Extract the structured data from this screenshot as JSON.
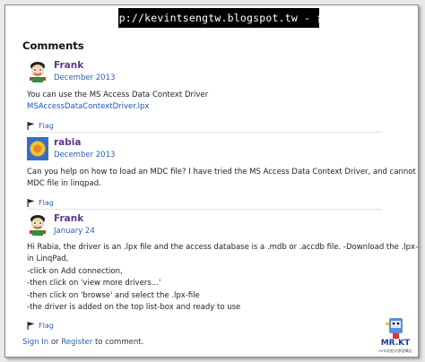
{
  "banner": {
    "text": "http://kevintsengtw.blogspot.tw - 台灣"
  },
  "comments_heading": "Comments",
  "comments": [
    {
      "author": "Frank",
      "date": "December 2013",
      "lines": [
        "You can use the MS Access Data Context Driver"
      ],
      "link": "MSAccessDataContextDriver.lpx",
      "flag": "Flag"
    },
    {
      "author": "rabia",
      "date": "December 2013",
      "lines": [
        "Can you help on how to load an MDC file? I have tried the MS Access Data Context Driver, and cannot load",
        "MDC file in linqpad."
      ],
      "flag": "Flag"
    },
    {
      "author": "Frank",
      "date": "January 24",
      "lines": [
        "Hi Rabia, the driver is an .lpx file and the access database is a .mdb or .accdb file. -Download the .lpx-file,",
        "in LinqPad,",
        "-click on Add connection,",
        "-then click on 'view more drivers...'",
        "-then click on 'browse' and select the .lpx-file",
        "-the driver is added on the top list-box and ready to use"
      ],
      "flag": "Flag"
    }
  ],
  "footer": {
    "sign_in": "Sign In",
    "or": " or ",
    "register": "Register",
    "suffix": " to comment."
  },
  "logo": {
    "text": "MR.KT",
    "subtext": "mrkt的程式學習筆記"
  }
}
